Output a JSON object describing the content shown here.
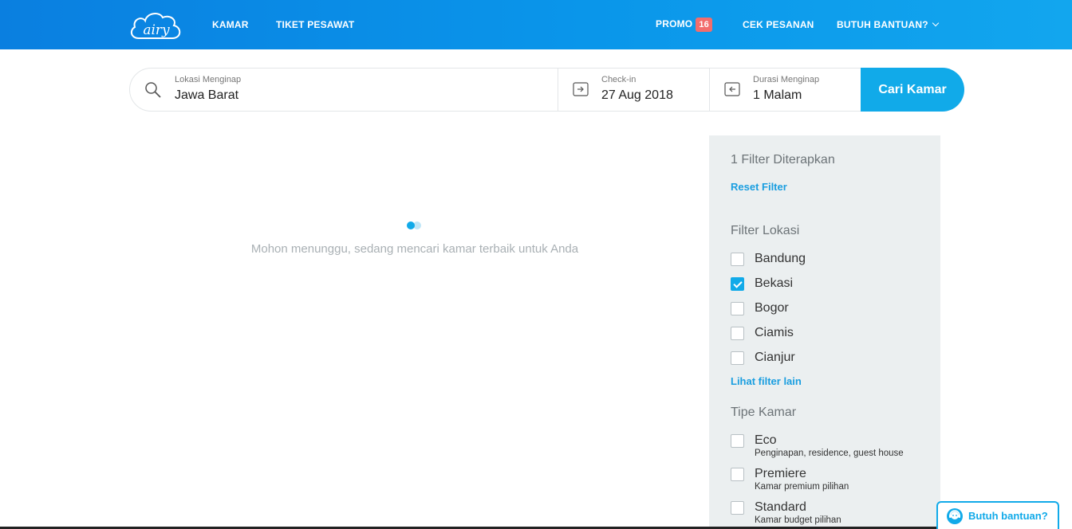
{
  "nav": {
    "brand": "airy",
    "links": [
      "KAMAR",
      "TIKET PESAWAT"
    ],
    "promo_label": "PROMO",
    "promo_count": "16",
    "cek_pesanan": "CEK PESANAN",
    "help_menu": "BUTUH BANTUAN?"
  },
  "search": {
    "location_label": "Lokasi Menginap",
    "location_value": "Jawa Barat",
    "checkin_label": "Check-in",
    "checkin_value": "27 Aug 2018",
    "duration_label": "Durasi Menginap",
    "duration_value": "1 Malam",
    "button": "Cari Kamar"
  },
  "loading": {
    "message": "Mohon menunggu, sedang mencari kamar terbaik untuk Anda"
  },
  "filters": {
    "applied": "1 Filter Diterapkan",
    "reset": "Reset Filter",
    "location_title": "Filter Lokasi",
    "locations": [
      {
        "label": "Bandung",
        "checked": false
      },
      {
        "label": "Bekasi",
        "checked": true
      },
      {
        "label": "Bogor",
        "checked": false
      },
      {
        "label": "Ciamis",
        "checked": false
      },
      {
        "label": "Cianjur",
        "checked": false
      }
    ],
    "more_link": "Lihat filter lain",
    "room_type_title": "Tipe Kamar",
    "room_types": [
      {
        "label": "Eco",
        "sub": "Penginapan, residence, guest house",
        "checked": false
      },
      {
        "label": "Premiere",
        "sub": "Kamar premium pilihan",
        "checked": false
      },
      {
        "label": "Standard",
        "sub": "Kamar budget pilihan",
        "checked": false
      }
    ]
  },
  "help_button": "Butuh bantuan?",
  "colors": {
    "primary": "#11aae9",
    "nav_start": "#0a7fe0",
    "badge": "#f26d6d",
    "panel": "#ebeff0"
  }
}
